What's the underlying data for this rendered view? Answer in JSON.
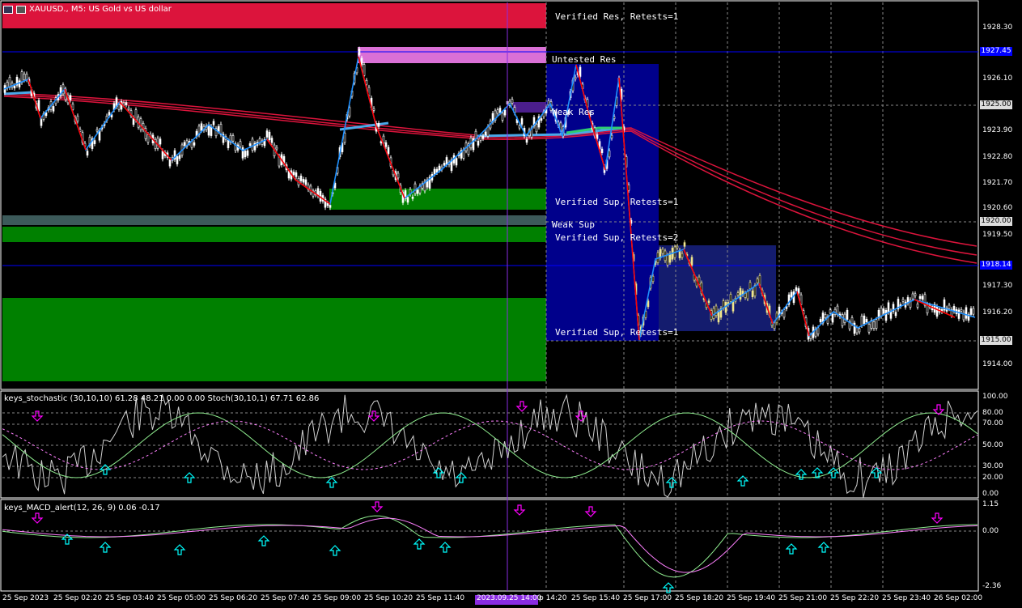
{
  "symbol_header": {
    "text": "XAUUSD., M5: US Gold vs US dollar",
    "icons": [
      "chart-window-icon",
      "symbol-flag-icon"
    ]
  },
  "zones": {
    "verified_res_1": "Verified Res, Retests=1",
    "untested_res": "Untested Res",
    "weak_res": "Weak Res",
    "verified_sup_1a": "Verified Sup, Retests=1",
    "weak_sup": "Weak Sup",
    "verified_sup_2": "Verified Sup, Retests=2",
    "verified_sup_1b": "Verified Sup, Retests=1"
  },
  "price_axis": [
    "1928.30",
    "1926.10",
    "1923.90",
    "1922.80",
    "1921.70",
    "1920.60",
    "1919.50",
    "1917.30",
    "1916.20",
    "1914.00"
  ],
  "price_tags": {
    "line_top": "1927.45",
    "level_1925": "1925.00",
    "level_1920": "1920.00",
    "line_bottom": "1918.14",
    "level_1915": "1915.00"
  },
  "stoch_header": "keys_stochastic (30,10,10) 61.28 48.21 0.00 0.00 Stoch(30,10,1) 67.71 62.86",
  "stoch_axis": [
    "100.00",
    "80.00",
    "70.00",
    "50.00",
    "30.00",
    "20.00",
    "0.00"
  ],
  "macd_header": "keys_MACD_alert(12, 26, 9) 0.06 -0.17",
  "macd_axis": [
    "1.15",
    "0.00",
    "-2.36"
  ],
  "time_axis": [
    "25 Sep 2023",
    "25 Sep 02:20",
    "25 Sep 03:40",
    "25 Sep 05:00",
    "25 Sep 06:20",
    "25 Sep 07:40",
    "25 Sep 09:00",
    "25 Sep 10:20",
    "25 Sep 11:40",
    "p 14:20",
    "25 Sep 15:40",
    "25 Sep 17:00",
    "25 Sep 18:20",
    "25 Sep 19:40",
    "25 Sep 21:00",
    "25 Sep 22:20",
    "25 Sep 23:40",
    "26 Sep 02:00"
  ],
  "cursor_time": "2023.09.25 14:00",
  "colors": {
    "resistance": "#dc143c",
    "support": "#008000",
    "weak_sup": "#3c5a5a",
    "untested": "#da70d6",
    "weak_res": "#5a1e8c",
    "navy_box": "#000080",
    "hline": "#0000ff",
    "cursor": "#8a2be2",
    "zigzag_up": "#1e90ff",
    "zigzag_down": "#ff0000",
    "ma": "#dc143c",
    "arrow_up": "#00ffff",
    "arrow_down": "#ff00ff"
  }
}
